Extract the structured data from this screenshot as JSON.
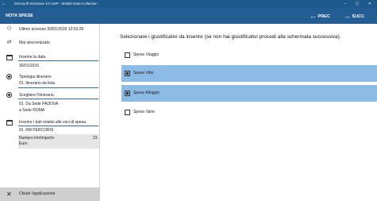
{
  "window": {
    "title": "Microsoft Windows 10 UWP - Mobile Data Collection",
    "back_glyph": "←",
    "controls": "–  ▢  ✕"
  },
  "appbar": {
    "title": "NOTA SPESE",
    "prev_arrow": "←",
    "prev_label": "PREC",
    "next_arrow": "→",
    "next_label": "SUCC"
  },
  "sidebar": {
    "last_access": "Ultimo accesso 30/01/2016 12:03:28",
    "sync_status": "Mai sincronizzato",
    "date_label": "Inserire la data.",
    "date_value": "30/01/2016",
    "itinerary_type_label": "Tipologia itinerario",
    "itinerary_type_value": "01. Itinerario da lista",
    "itinerary_choice_label": "Scegliere l'itinerario.",
    "itinerary_from": "01. Da Sede PADOVA",
    "itinerary_to": "a Sede ROMA",
    "expenses_label": "Inserire i dati relativi alle voci di spesa.",
    "km_label": "01. KM PERCORSI",
    "km_field_label": "Numero km/Importo",
    "km_field_unit": "Euro",
    "km_field_value": "23",
    "close_label": "Chiudi l'applicazione"
  },
  "main": {
    "prompt": "Selezionare i giustificativi da inserire (se non hai giustificativi procedi alla schermata successiva).",
    "options": [
      {
        "label": "Spese Viaggio",
        "checked": false
      },
      {
        "label": "Spese Vitto",
        "checked": true
      },
      {
        "label": "Spese Alloggio",
        "checked": true
      },
      {
        "label": "Spese Varie",
        "checked": false
      }
    ]
  },
  "colors": {
    "titlebar": "#1f5a8f",
    "appbar": "#245e94",
    "selected_row": "#8cbbe6",
    "footer": "#cfcfcf"
  }
}
